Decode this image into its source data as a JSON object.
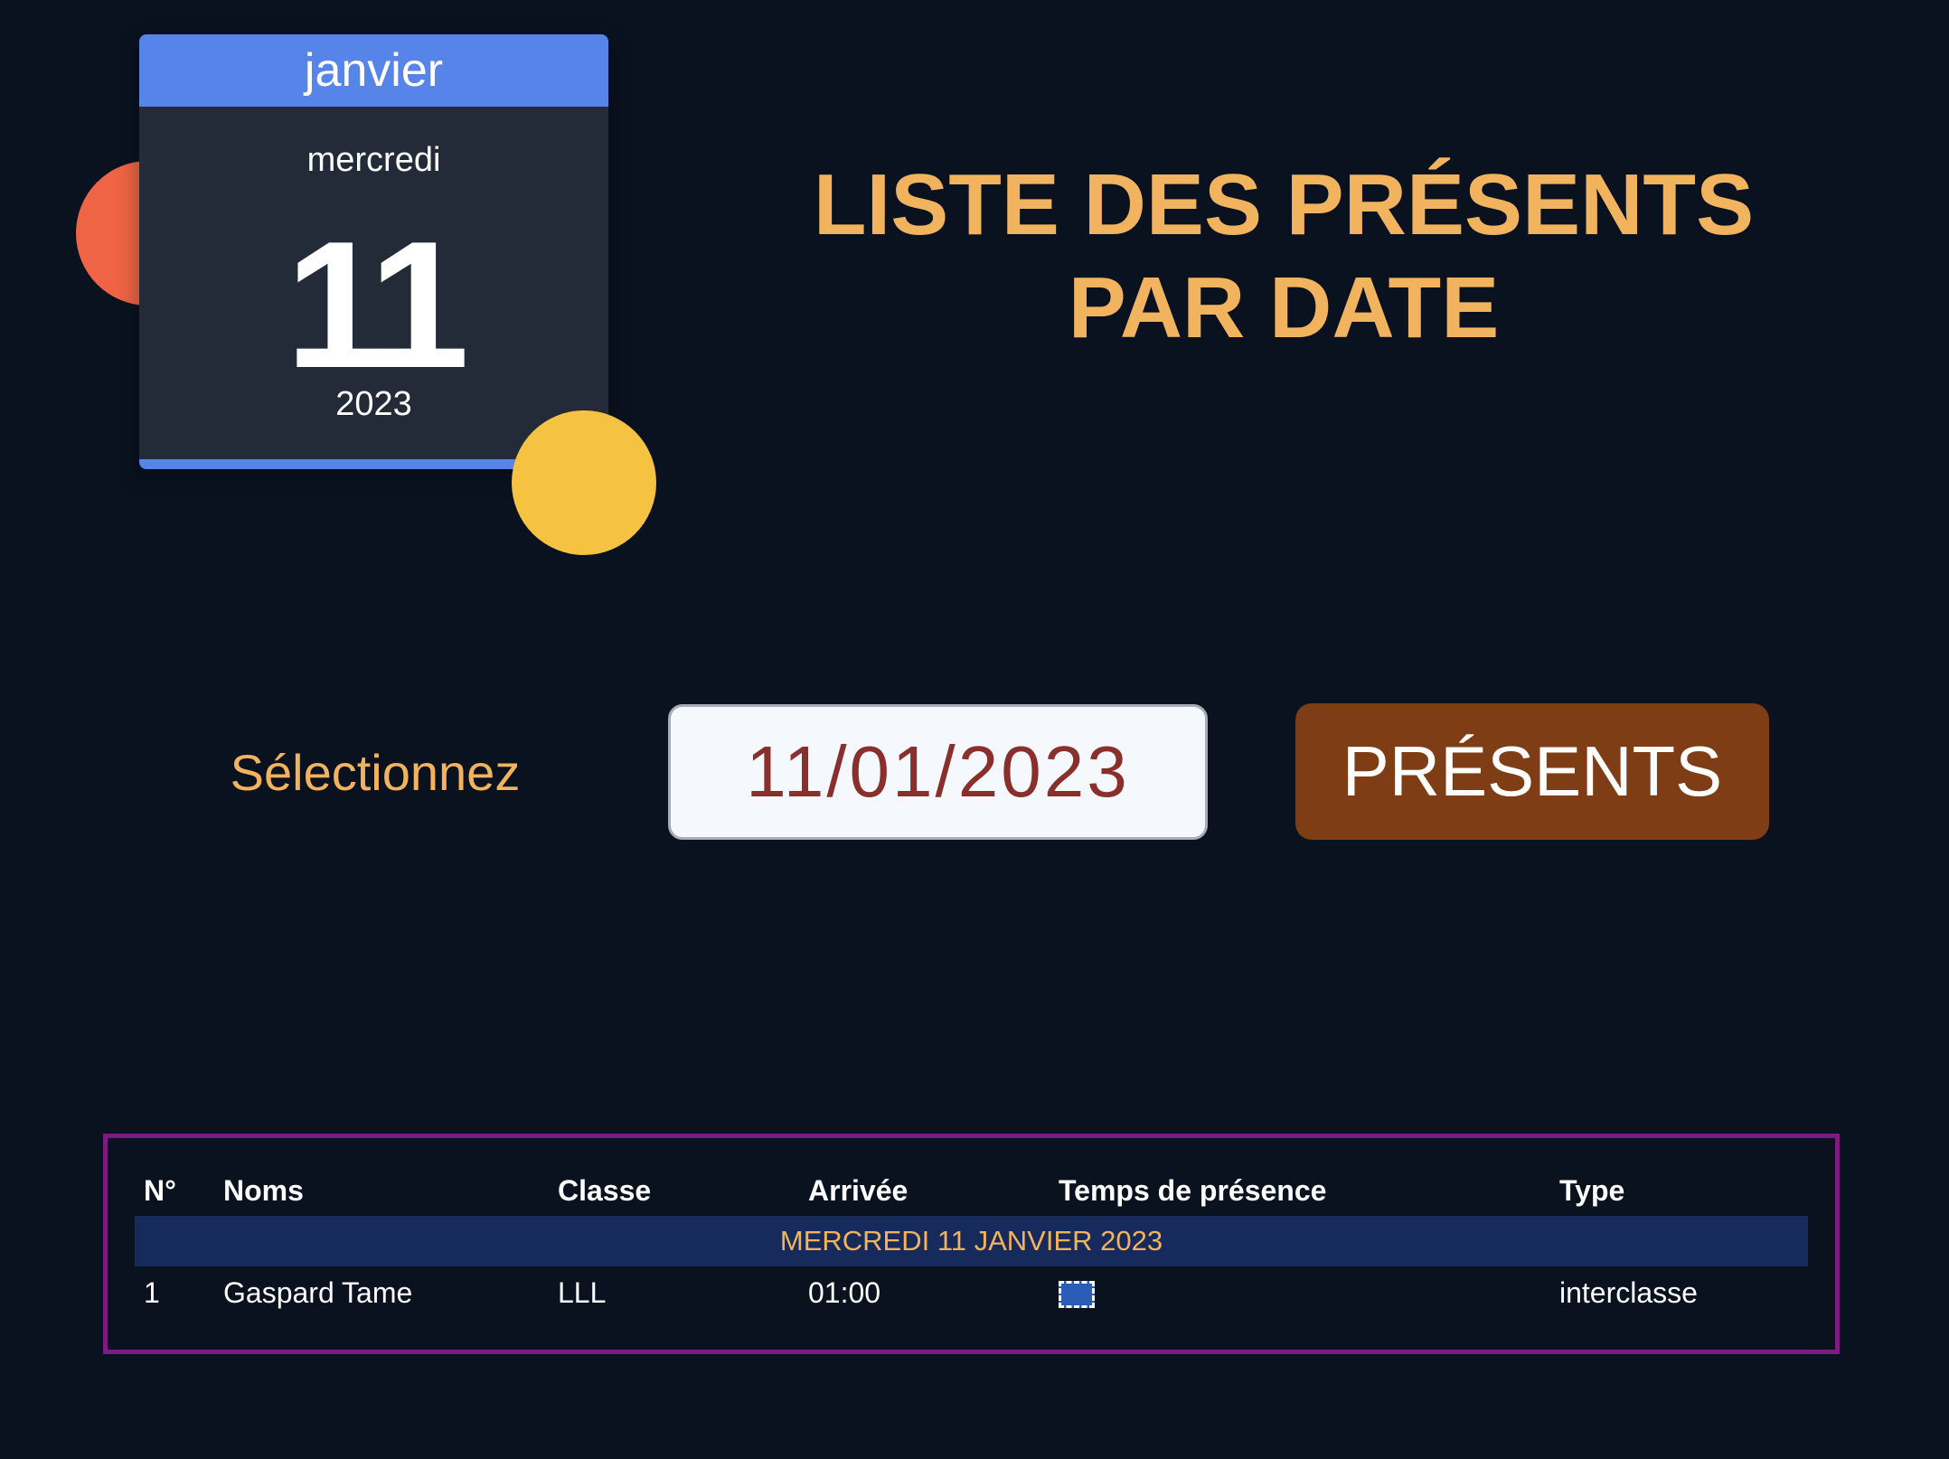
{
  "calendar": {
    "month": "janvier",
    "weekday": "mercredi",
    "day": "11",
    "year": "2023"
  },
  "page_title": "LISTE DES PRÉSENTS PAR DATE",
  "controls": {
    "select_label": "Sélectionnez",
    "date_value": "11/01/2023",
    "submit_label": "PRÉSENTS"
  },
  "table": {
    "headers": {
      "num": "N°",
      "name": "Noms",
      "class": "Classe",
      "arrival": "Arrivée",
      "presence": "Temps de présence",
      "type": "Type"
    },
    "group_label": "MERCREDI 11 JANVIER 2023",
    "rows": [
      {
        "num": "1",
        "name": "Gaspard Tame",
        "class": "LLL",
        "arrival": "01:00",
        "type": "interclasse"
      }
    ]
  },
  "colors": {
    "background": "#0a1220",
    "accent_orange": "#f2b35e",
    "calendar_blue": "#5784e9",
    "button_brown": "#7e3d15",
    "table_border": "#7e1b82",
    "group_row": "#172a5c"
  }
}
